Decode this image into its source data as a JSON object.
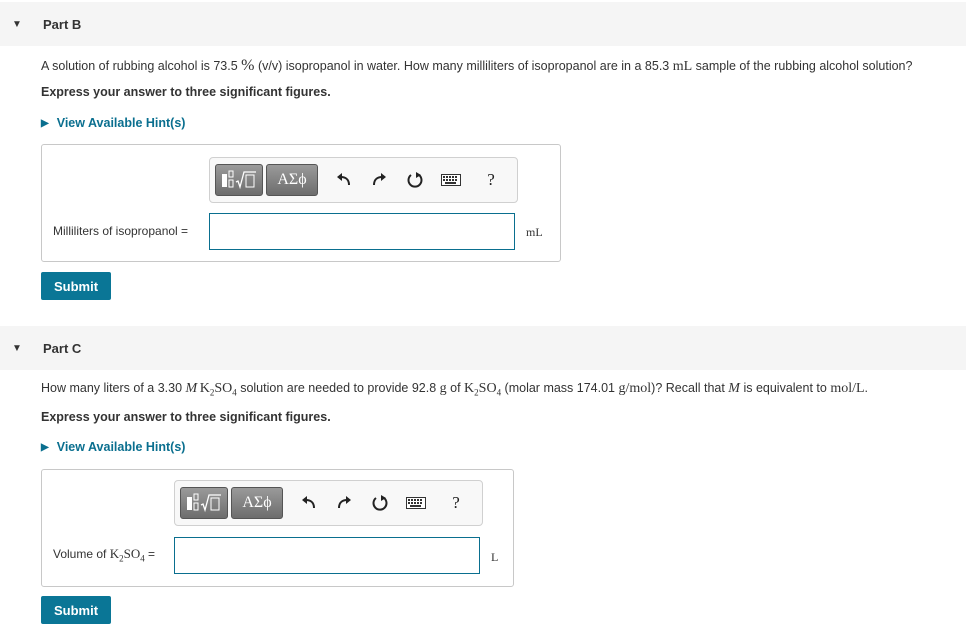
{
  "part_b": {
    "title": "Part B",
    "question": {
      "t1": "A solution of rubbing alcohol is 73.5 ",
      "percent": "%",
      "t2": " (v/v) isopropanol in water. How many milliliters of isopropanol are in a 85.3 ",
      "unit_ml": "mL",
      "t3": " sample of the rubbing alcohol solution?"
    },
    "instruction": "Express your answer to three significant figures.",
    "hint_label": "View Available Hint(s)",
    "field_label": "Milliliters of isopropanol =",
    "input_value": "",
    "unit": "mL",
    "submit_label": "Submit"
  },
  "part_c": {
    "title": "Part C",
    "question": {
      "t1": "How many liters of a 3.30 ",
      "M": "M",
      "formula_a": "K",
      "sub_a1": "2",
      "formula_b": "SO",
      "sub_a2": "4",
      "t2": " solution are needed to provide 92.8 ",
      "unit_g": "g",
      "t3": " of ",
      "formula_c": "K",
      "sub_c1": "2",
      "formula_d": "SO",
      "sub_c2": "4",
      "t4": " (molar mass 174.01 ",
      "molar_unit": "g/mol",
      "t5": ")? Recall that ",
      "M2": "M",
      "t6": " is equivalent to ",
      "equiv_unit": "mol/L",
      "t7": "."
    },
    "instruction": "Express your answer to three significant figures.",
    "hint_label": "View Available Hint(s)",
    "field_label": {
      "t1": "Volume of ",
      "k": "K",
      "sub1": "2",
      "so": "SO",
      "sub2": "4",
      "eq": " ="
    },
    "input_value": "",
    "unit": "L",
    "submit_label": "Submit"
  },
  "toolbar": {
    "greek_label": "ΑΣϕ",
    "help_label": "?",
    "icons": [
      "templates-icon",
      "greek-symbols-icon",
      "undo-icon",
      "redo-icon",
      "reset-icon",
      "keyboard-icon",
      "help-icon"
    ]
  },
  "colors": {
    "link": "#0a6f8f",
    "submit": "#0a7696",
    "header_bg": "#f5f5f5",
    "input_border": "#0a6f8f"
  }
}
